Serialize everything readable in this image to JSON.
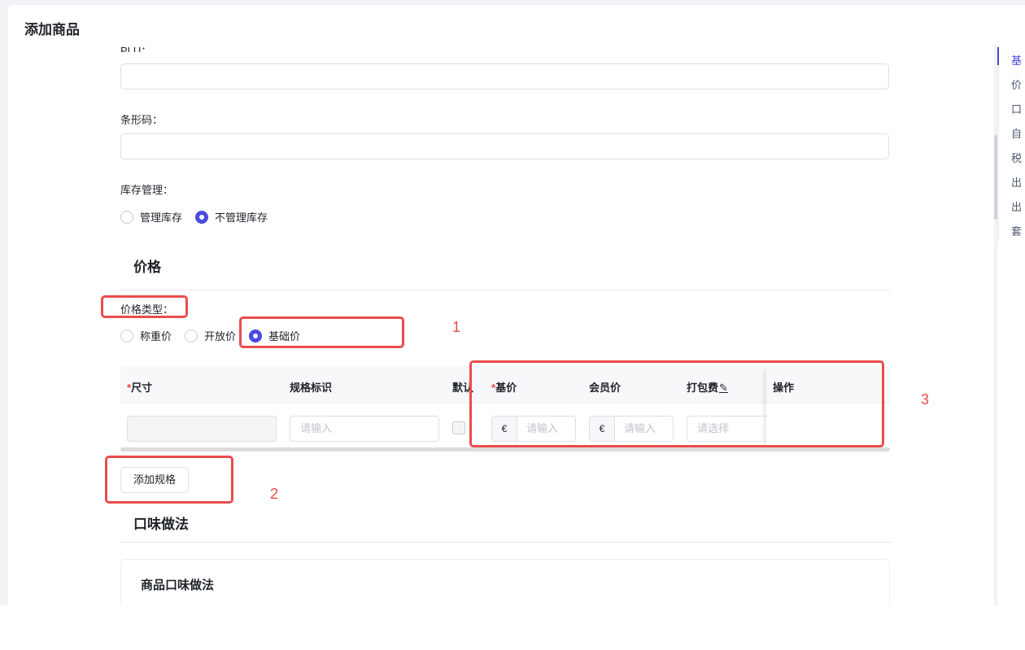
{
  "page_title": "添加商品",
  "form": {
    "plu_label": "PLU：",
    "plu_value": "",
    "barcode_label": "条形码：",
    "barcode_value": "",
    "stock_label": "库存管理：",
    "stock_options": [
      {
        "label": "管理库存",
        "checked": false
      },
      {
        "label": "不管理库存",
        "checked": true
      }
    ]
  },
  "price_section": {
    "title": "价格",
    "price_type_label": "价格类型：",
    "price_type_options": [
      {
        "label": "称重价",
        "checked": false
      },
      {
        "label": "开放价",
        "checked": false
      },
      {
        "label": "基础价",
        "checked": true
      }
    ],
    "table": {
      "headers": {
        "size": "尺寸",
        "spec_id": "规格标识",
        "default": "默认",
        "base_price": "基价",
        "member_price": "会员价",
        "packing_fee": "打包费",
        "actions": "操作"
      },
      "required_mark": "*",
      "row": {
        "size_value": "",
        "spec_placeholder": "请输入",
        "currency_symbol": "€",
        "base_price_placeholder": "请输入",
        "member_price_placeholder": "请输入",
        "packing_fee_placeholder": "请选择"
      }
    },
    "add_spec_button": "添加规格"
  },
  "flavor_section": {
    "title": "口味做法",
    "card_title": "商品口味做法"
  },
  "annotations": {
    "n1": "1",
    "n2": "2",
    "n3": "3",
    "color": "#e94c4c"
  },
  "anchor_nav": {
    "items": [
      "基",
      "价",
      "口",
      "自",
      "税",
      "出",
      "出",
      "套"
    ],
    "active_index": 0
  },
  "colors": {
    "primary": "#4a4ae0",
    "required": "#f53f3f"
  }
}
